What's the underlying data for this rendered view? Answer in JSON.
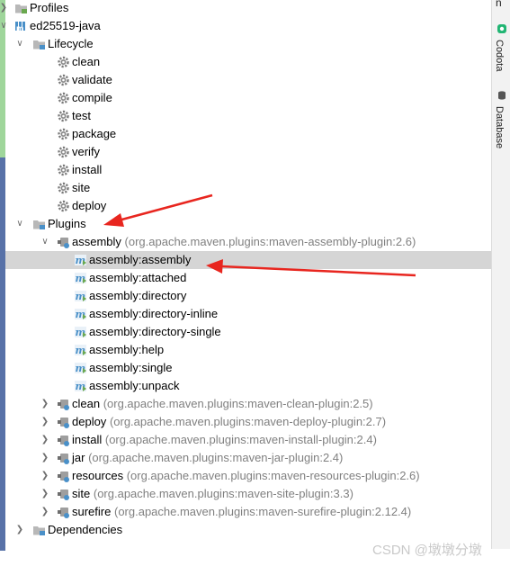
{
  "tree": {
    "rows": [
      {
        "label": "Profiles",
        "sub": "",
        "arrow": "right",
        "icon": "profiles-folder-icon",
        "depth": 0
      },
      {
        "label": "ed25519-java",
        "sub": "",
        "arrow": "down",
        "icon": "maven-project-icon",
        "depth": 0
      },
      {
        "label": "Lifecycle",
        "sub": "",
        "arrow": "down",
        "icon": "lifecycle-folder-icon",
        "depth": 1
      },
      {
        "label": "clean",
        "sub": "",
        "arrow": "",
        "icon": "gear-icon",
        "depth": 2
      },
      {
        "label": "validate",
        "sub": "",
        "arrow": "",
        "icon": "gear-icon",
        "depth": 2
      },
      {
        "label": "compile",
        "sub": "",
        "arrow": "",
        "icon": "gear-icon",
        "depth": 2
      },
      {
        "label": "test",
        "sub": "",
        "arrow": "",
        "icon": "gear-icon",
        "depth": 2
      },
      {
        "label": "package",
        "sub": "",
        "arrow": "",
        "icon": "gear-icon",
        "depth": 2
      },
      {
        "label": "verify",
        "sub": "",
        "arrow": "",
        "icon": "gear-icon",
        "depth": 2
      },
      {
        "label": "install",
        "sub": "",
        "arrow": "",
        "icon": "gear-icon",
        "depth": 2
      },
      {
        "label": "site",
        "sub": "",
        "arrow": "",
        "icon": "gear-icon",
        "depth": 2
      },
      {
        "label": "deploy",
        "sub": "",
        "arrow": "",
        "icon": "gear-icon",
        "depth": 2
      },
      {
        "label": "Plugins",
        "sub": "",
        "arrow": "down",
        "icon": "plugins-folder-icon",
        "depth": 1
      },
      {
        "label": "assembly",
        "sub": "(org.apache.maven.plugins:maven-assembly-plugin:2.6)",
        "arrow": "down",
        "icon": "plugin-icon",
        "depth": 2
      },
      {
        "label": "assembly:assembly",
        "sub": "",
        "arrow": "",
        "icon": "maven-goal-icon",
        "depth": 3,
        "selected": true
      },
      {
        "label": "assembly:attached",
        "sub": "",
        "arrow": "",
        "icon": "maven-goal-icon",
        "depth": 3
      },
      {
        "label": "assembly:directory",
        "sub": "",
        "arrow": "",
        "icon": "maven-goal-icon",
        "depth": 3
      },
      {
        "label": "assembly:directory-inline",
        "sub": "",
        "arrow": "",
        "icon": "maven-goal-icon",
        "depth": 3
      },
      {
        "label": "assembly:directory-single",
        "sub": "",
        "arrow": "",
        "icon": "maven-goal-icon",
        "depth": 3
      },
      {
        "label": "assembly:help",
        "sub": "",
        "arrow": "",
        "icon": "maven-goal-icon",
        "depth": 3
      },
      {
        "label": "assembly:single",
        "sub": "",
        "arrow": "",
        "icon": "maven-goal-icon",
        "depth": 3
      },
      {
        "label": "assembly:unpack",
        "sub": "",
        "arrow": "",
        "icon": "maven-goal-icon",
        "depth": 3
      },
      {
        "label": "clean",
        "sub": "(org.apache.maven.plugins:maven-clean-plugin:2.5)",
        "arrow": "right",
        "icon": "plugin-icon",
        "depth": 2
      },
      {
        "label": "deploy",
        "sub": "(org.apache.maven.plugins:maven-deploy-plugin:2.7)",
        "arrow": "right",
        "icon": "plugin-icon",
        "depth": 2
      },
      {
        "label": "install",
        "sub": "(org.apache.maven.plugins:maven-install-plugin:2.4)",
        "arrow": "right",
        "icon": "plugin-icon",
        "depth": 2
      },
      {
        "label": "jar",
        "sub": "(org.apache.maven.plugins:maven-jar-plugin:2.4)",
        "arrow": "right",
        "icon": "plugin-icon",
        "depth": 2
      },
      {
        "label": "resources",
        "sub": "(org.apache.maven.plugins:maven-resources-plugin:2.6)",
        "arrow": "right",
        "icon": "plugin-icon",
        "depth": 2
      },
      {
        "label": "site",
        "sub": "(org.apache.maven.plugins:maven-site-plugin:3.3)",
        "arrow": "right",
        "icon": "plugin-icon",
        "depth": 2
      },
      {
        "label": "surefire",
        "sub": "(org.apache.maven.plugins:maven-surefire-plugin:2.12.4)",
        "arrow": "right",
        "icon": "plugin-icon",
        "depth": 2
      },
      {
        "label": "Dependencies",
        "sub": "",
        "arrow": "right",
        "icon": "dependencies-folder-icon",
        "depth": 1
      }
    ]
  },
  "right_panel": {
    "tabs": [
      {
        "label": "Codota",
        "icon": "codota-icon"
      },
      {
        "label": "Database",
        "icon": "database-icon"
      }
    ],
    "top_fragment": "n"
  },
  "watermark": "CSDN @墩墩分墩",
  "colors": {
    "selected_row": "#d5d5d5",
    "annotation_arrow": "#e8261f",
    "secondary_text": "#808080",
    "maven_blue": "#4a90c8"
  }
}
